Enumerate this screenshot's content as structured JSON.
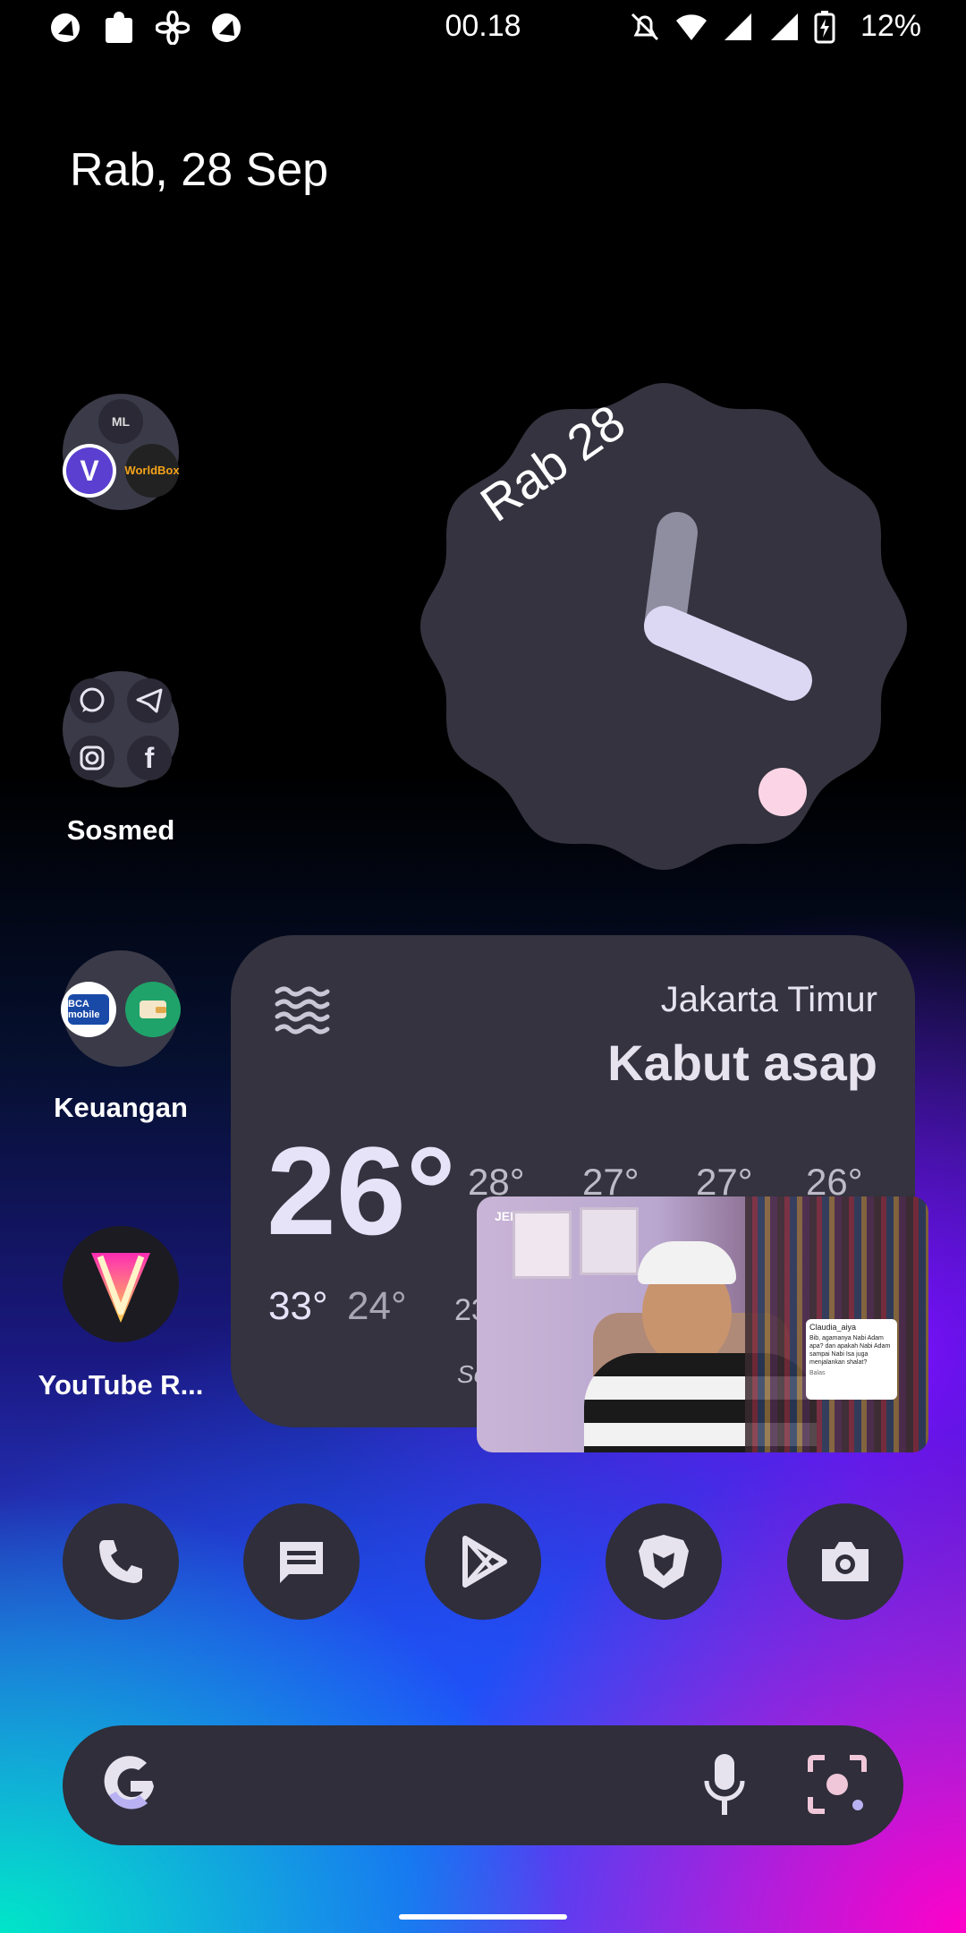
{
  "status_bar": {
    "time": "00.18",
    "battery": "12%",
    "left_icons": [
      "notification-icon",
      "puzzle-icon",
      "fan-icon",
      "notification-icon"
    ],
    "right_icons": [
      "bell-off-icon",
      "wifi-icon",
      "signal-icon",
      "signal-icon",
      "battery-charging-icon"
    ]
  },
  "home": {
    "date": "Rab, 28 Sep",
    "folders": [
      {
        "label": "",
        "apps": [
          "ML",
          "V",
          "WorldBox"
        ]
      },
      {
        "label": "Sosmed",
        "apps": [
          "whatsapp-icon",
          "telegram-icon",
          "instagram-icon",
          "facebook-icon"
        ]
      },
      {
        "label": "Keuangan",
        "apps": [
          "BCA mobile",
          "wallet-icon"
        ]
      },
      {
        "label": "YouTube R..."
      }
    ]
  },
  "clock_widget": {
    "date_label": "Rab 28",
    "hour": 0,
    "minute": 18
  },
  "weather_widget": {
    "city": "Jakarta Timur",
    "condition": "Kabut asap",
    "temp": "26°",
    "high": "33°",
    "low": "24°",
    "forecast_temps": [
      "28°",
      "27°",
      "27°",
      "26°"
    ],
    "partial_labels": [
      "23",
      "Se"
    ]
  },
  "pip_video": {
    "channel_tag": "JEDA NULIS",
    "overlay_name": "Claudia_aiya",
    "overlay_text": "Bib, agamanya Nabi Adam apa? dan apakah Nabi Adam sampai Nabi Isa juga menjalankan shalat?",
    "overlay_footer": "Balas"
  },
  "dock": [
    "phone-icon",
    "messages-icon",
    "play-store-icon",
    "brave-icon",
    "camera-icon"
  ],
  "search_bar": {
    "icons": [
      "google-icon",
      "mic-icon",
      "lens-icon"
    ]
  }
}
